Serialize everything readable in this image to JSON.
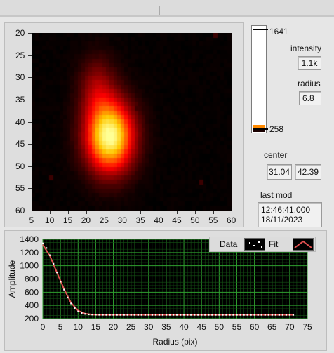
{
  "image_panel": {
    "y_ticks": [
      "20",
      "25",
      "30",
      "35",
      "40",
      "45",
      "50",
      "55",
      "60"
    ],
    "x_ticks": [
      "5",
      "10",
      "15",
      "20",
      "25",
      "30",
      "35",
      "40",
      "45",
      "50",
      "55",
      "60"
    ]
  },
  "colorbar": {
    "max_label": "1641",
    "min_label": "258"
  },
  "indicators": {
    "intensity_label": "intensity",
    "intensity_value": "1.1k",
    "radius_label": "radius",
    "radius_value": "6.8",
    "center_label": "center",
    "center_x": "31.04",
    "center_y": "42.39",
    "lastmod_label": "last mod",
    "lastmod_time": "12:46:41.000",
    "lastmod_date": "18/11/2023"
  },
  "chart_data": {
    "type": "scatter",
    "xlabel": "Radius (pix)",
    "ylabel": "Amplitude",
    "xlim": [
      0,
      75
    ],
    "ylim": [
      200,
      1400
    ],
    "x_ticks": [
      0,
      5,
      10,
      15,
      20,
      25,
      30,
      35,
      40,
      45,
      50,
      55,
      60,
      65,
      70,
      75
    ],
    "y_ticks": [
      200,
      400,
      600,
      800,
      1000,
      1200,
      1400
    ],
    "grid": true,
    "legend_position": "top-right",
    "series": [
      {
        "name": "Data",
        "style": "points",
        "color": "#ffffff",
        "x": [
          0,
          1,
          2,
          3,
          4,
          5,
          6,
          7,
          8,
          9,
          10,
          11,
          12,
          13,
          14,
          15,
          16,
          17,
          18,
          19,
          20,
          21,
          22,
          23,
          24,
          25,
          26,
          27,
          28,
          29,
          30,
          31,
          32,
          33,
          34,
          35,
          36,
          37,
          38,
          39,
          40,
          41,
          42,
          43,
          44,
          45,
          46,
          47,
          48,
          49,
          50,
          51,
          52,
          53,
          54,
          55,
          56,
          57,
          58,
          59,
          60,
          61,
          62,
          63,
          64,
          65,
          66,
          67,
          68,
          69,
          70,
          71
        ],
        "y": [
          1340,
          1270,
          1160,
          1030,
          900,
          760,
          640,
          520,
          430,
          360,
          310,
          285,
          272,
          265,
          262,
          260,
          259,
          259,
          258,
          258,
          258,
          258,
          258,
          258,
          258,
          258,
          258,
          258,
          258,
          258,
          258,
          258,
          258,
          258,
          258,
          258,
          258,
          258,
          258,
          258,
          258,
          258,
          258,
          258,
          258,
          258,
          258,
          258,
          258,
          258,
          258,
          258,
          258,
          258,
          258,
          258,
          258,
          258,
          258,
          258,
          258,
          258,
          258,
          258,
          258,
          258,
          258,
          258,
          258,
          258,
          258,
          258
        ]
      },
      {
        "name": "Fit",
        "style": "line",
        "color": "#e05050",
        "x": [
          0,
          2,
          4,
          6,
          8,
          10,
          12,
          14,
          16,
          18,
          20,
          25,
          30,
          40,
          50,
          60,
          71
        ],
        "y": [
          1320,
          1150,
          900,
          650,
          440,
          320,
          275,
          262,
          259,
          258,
          258,
          258,
          258,
          258,
          258,
          258,
          258
        ]
      }
    ]
  }
}
